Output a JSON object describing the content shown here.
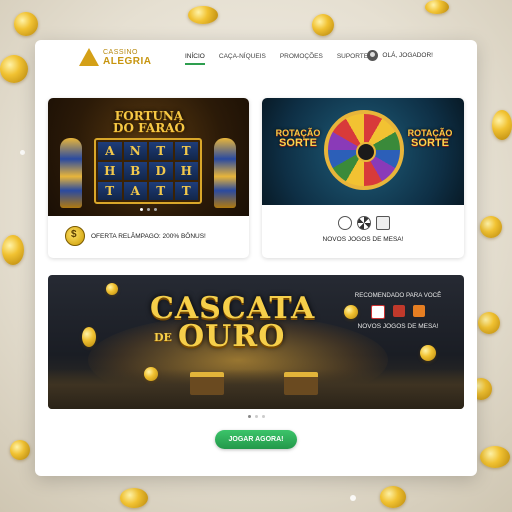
{
  "brand": {
    "top": "CASSINO",
    "bottom": "ALEGRIA",
    "accent": "#d4a017"
  },
  "nav": {
    "items": [
      {
        "label": "INÍCIO",
        "active": true
      },
      {
        "label": "CAÇA-NÍQUEIS",
        "active": false
      },
      {
        "label": "PROMOÇÕES",
        "active": false
      },
      {
        "label": "SUPORTE",
        "active": false
      }
    ],
    "user_label": "OLÁ, JOGADOR!"
  },
  "card_slot": {
    "title_line1": "FORTUNA",
    "title_line2": "DO FARAÓ",
    "reels": [
      "A",
      "N",
      "T",
      "T",
      "H",
      "B",
      "D",
      "H",
      "T",
      "A",
      "T",
      "T"
    ],
    "promo": "OFERTA RELÂMPAGO: 200% BÔNUS!"
  },
  "card_wheel": {
    "logo_left": {
      "line1": "ROTAÇÃO",
      "line2": "SORTE"
    },
    "logo_right": {
      "line1": "ROTAÇÃO",
      "line2": "SORTE"
    },
    "promo": "NOVOS JOGOS DE MESA!"
  },
  "banner": {
    "title_word1": "CASCATA",
    "title_de": "DE",
    "title_word2": "OURO",
    "rec_title": "RECOMENDADO PARA VOCÊ",
    "rec_sub": "NOVOS JOGOS DE MESA!"
  },
  "cta": {
    "label": "JOGAR AGORA!",
    "color": "#2fae5a"
  },
  "colors": {
    "gold": "#f6cf4a",
    "green_accent": "#2e9e4f"
  }
}
